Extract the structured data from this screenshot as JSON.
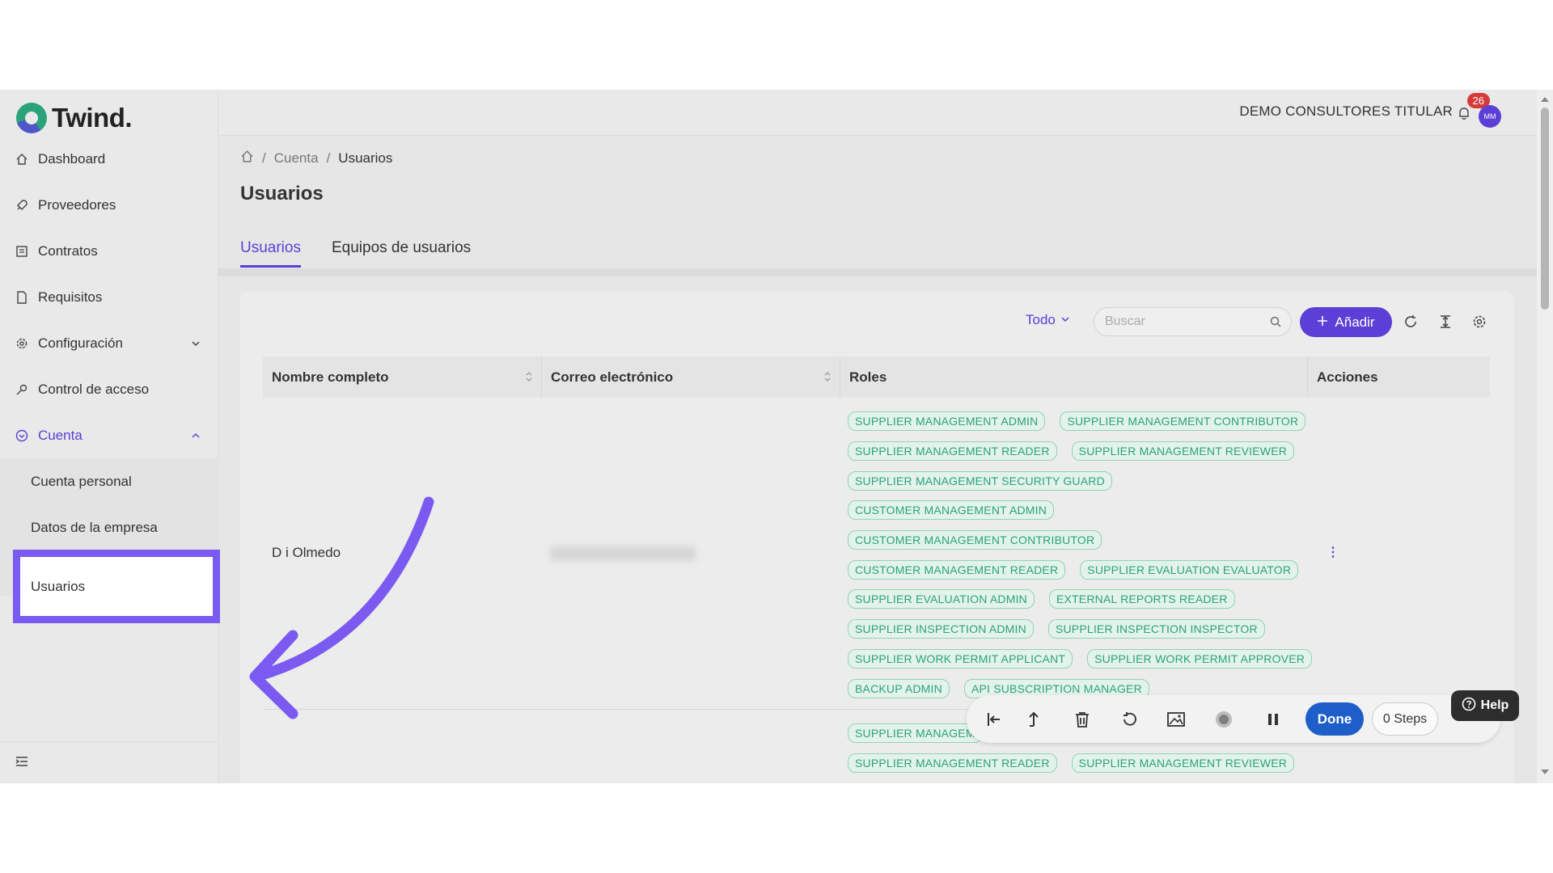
{
  "app": {
    "brand": "Twind."
  },
  "sidebar": {
    "items": [
      {
        "label": "Dashboard",
        "icon": "home-icon"
      },
      {
        "label": "Proveedores",
        "icon": "rocket-icon"
      },
      {
        "label": "Contratos",
        "icon": "contract-icon"
      },
      {
        "label": "Requisitos",
        "icon": "file-icon"
      },
      {
        "label": "Configuración",
        "icon": "gear-icon"
      },
      {
        "label": "Control de acceso",
        "icon": "key-icon"
      },
      {
        "label": "Cuenta",
        "icon": "account-icon"
      }
    ],
    "subitems": [
      {
        "label": "Cuenta personal"
      },
      {
        "label": "Datos de la empresa"
      },
      {
        "label": "Usuarios"
      }
    ]
  },
  "topbar": {
    "org_name": "DEMO CONSULTORES TITULAR",
    "notification_count": "26",
    "avatar_initials": "MM"
  },
  "breadcrumb": {
    "level1": "Cuenta",
    "separator": "/",
    "current": "Usuarios"
  },
  "page": {
    "title": "Usuarios"
  },
  "tabs": [
    {
      "label": "Usuarios"
    },
    {
      "label": "Equipos de usuarios"
    }
  ],
  "toolbar": {
    "filter_value": "Todo",
    "search_placeholder": "Buscar",
    "add_label": "Añadir"
  },
  "table": {
    "columns": [
      "Nombre completo",
      "Correo electrónico",
      "Roles",
      "Acciones"
    ],
    "rows": [
      {
        "name": "D   i Olmedo",
        "roles": [
          [
            "SUPPLIER MANAGEMENT ADMIN",
            "SUPPLIER MANAGEMENT CONTRIBUTOR"
          ],
          [
            "SUPPLIER MANAGEMENT READER",
            "SUPPLIER MANAGEMENT REVIEWER"
          ],
          [
            "SUPPLIER MANAGEMENT SECURITY GUARD"
          ],
          [
            "CUSTOMER MANAGEMENT ADMIN"
          ],
          [
            "CUSTOMER MANAGEMENT CONTRIBUTOR"
          ],
          [
            "CUSTOMER MANAGEMENT READER",
            "SUPPLIER EVALUATION EVALUATOR"
          ],
          [
            "SUPPLIER EVALUATION ADMIN",
            "EXTERNAL REPORTS READER"
          ],
          [
            "SUPPLIER INSPECTION ADMIN",
            "SUPPLIER INSPECTION INSPECTOR"
          ],
          [
            "SUPPLIER WORK PERMIT APPLICANT",
            "SUPPLIER WORK PERMIT APPROVER"
          ],
          [
            "BACKUP ADMIN",
            "API SUBSCRIPTION MANAGER"
          ]
        ]
      },
      {
        "roles": [
          [
            "SUPPLIER MANAGEM"
          ],
          [
            "SUPPLIER MANAGEMENT READER",
            "SUPPLIER MANAGEMENT REVIEWER"
          ]
        ]
      }
    ]
  },
  "recorder": {
    "done_label": "Done",
    "steps_label": "0 Steps",
    "help_label": "Help"
  },
  "colors": {
    "accent": "#5b3fd6",
    "role_green": "#2aa37a",
    "done_blue": "#1d5ec9",
    "highlight": "#7a5af0"
  }
}
